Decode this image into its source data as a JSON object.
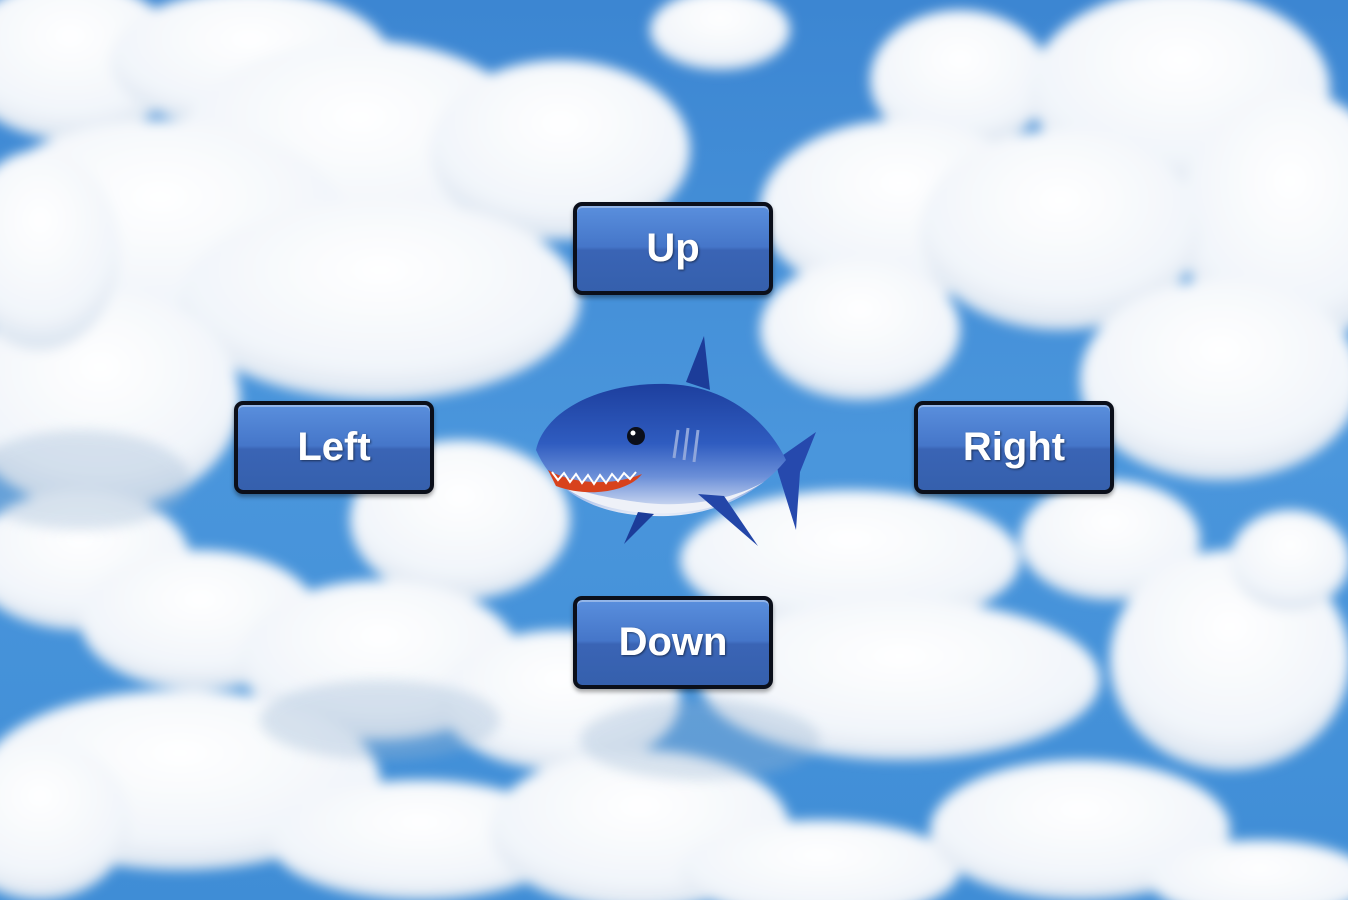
{
  "scene": {
    "background": "sky-with-clouds",
    "sky_color": "#3f8ed6",
    "cloud_color": "#ffffff"
  },
  "character": {
    "icon": "shark-icon",
    "body_color": "#2a55b5",
    "belly_color": "#f2f4fa",
    "mouth_color": "#d8421c"
  },
  "controls": {
    "up_label": "Up",
    "down_label": "Down",
    "left_label": "Left",
    "right_label": "Right",
    "button_color": "#4576c9",
    "border_color": "#0b0f1a"
  }
}
